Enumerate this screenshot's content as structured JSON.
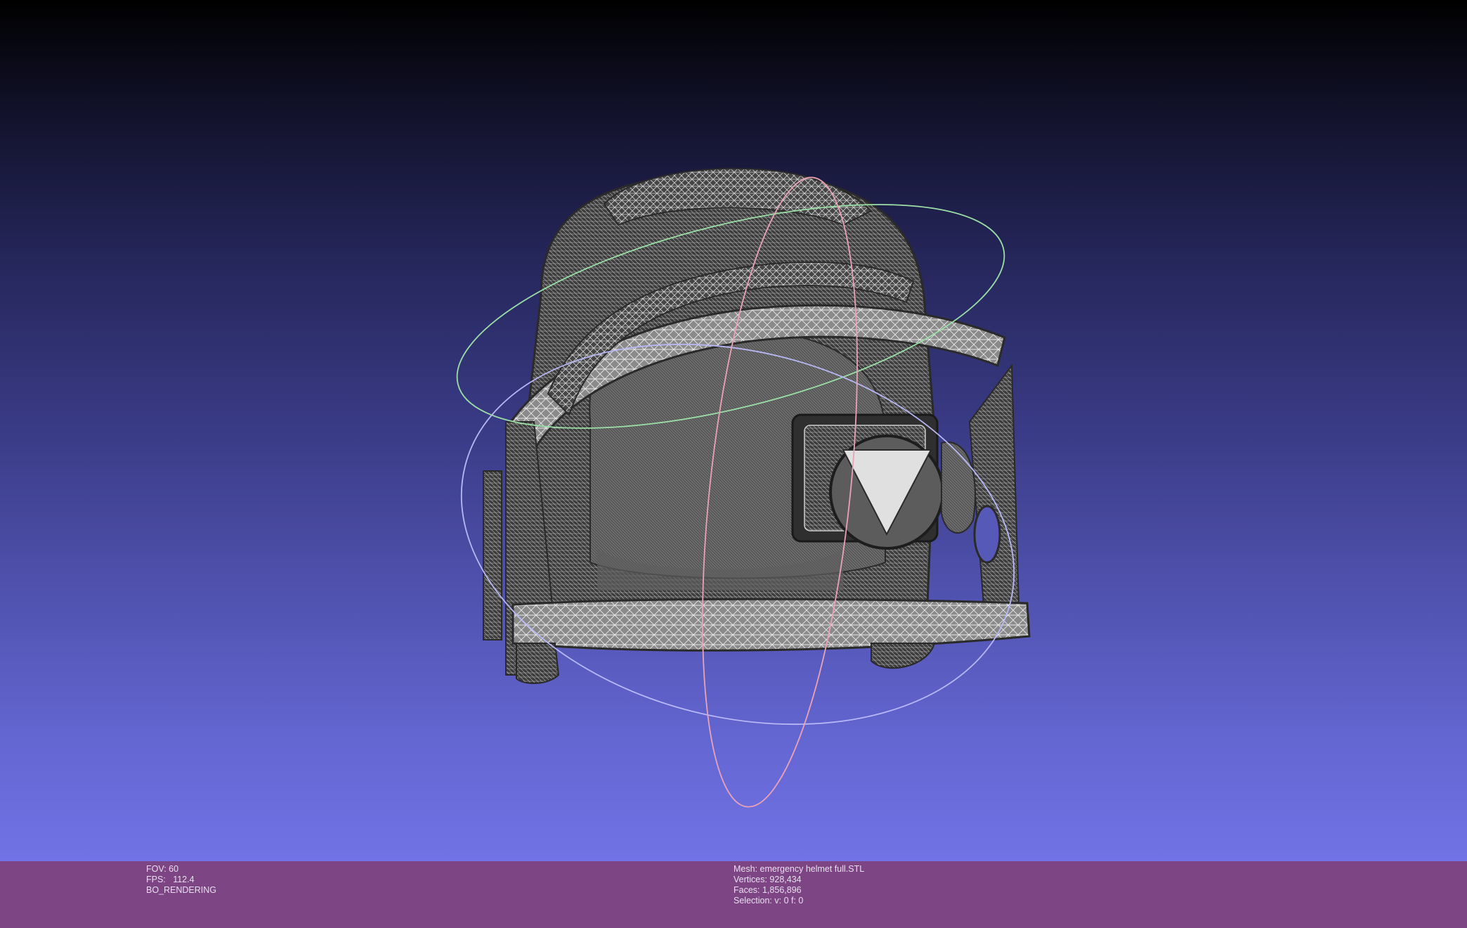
{
  "viewport": {
    "background_top": "#000000",
    "background_bottom": "#7173e6",
    "mesh_color": "#4a4a4a",
    "wire_color": "#d9d9d9",
    "trackball_colors": {
      "x_ring": "#e9a3b4",
      "y_ring": "#9be0a6",
      "z_ring": "#b7b8f5"
    }
  },
  "status_bar": {
    "color": "#7d4583",
    "left": {
      "fov": "FOV: 60",
      "fps": "FPS:   112.4",
      "mode": "BO_RENDERING"
    },
    "right": {
      "mesh": "Mesh: emergency helmet full.STL",
      "vertices": "Vertices: 928,434",
      "faces": "Faces: 1,856,896",
      "selection": "Selection: v: 0 f: 0"
    }
  }
}
